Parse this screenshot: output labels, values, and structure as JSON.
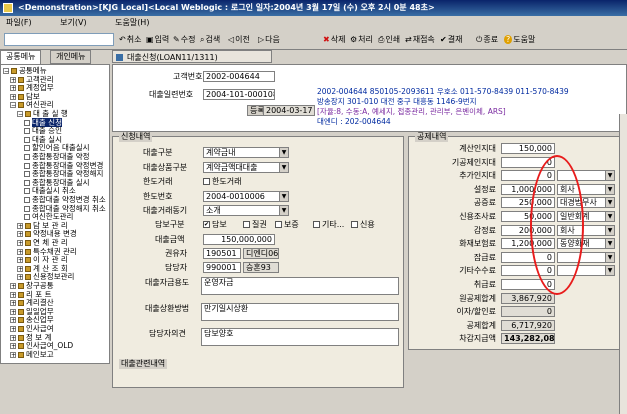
{
  "window": {
    "title": "<Demonstration>[KJG Local]<Local Weblogic : 로그인 일자:2004년 3월 17일 (수) 오후 2시 0분 48초>"
  },
  "menu": [
    "파일(F)",
    "보기(V)",
    "도움말(H)"
  ],
  "toolbar": [
    {
      "icon": "cancel-icon",
      "label": "취소"
    },
    {
      "icon": "new-icon",
      "label": "입력"
    },
    {
      "icon": "edit-icon",
      "label": "수정"
    },
    {
      "icon": "search-icon",
      "label": "검색"
    },
    {
      "icon": "prev-icon",
      "label": "이전"
    },
    {
      "icon": "next-icon",
      "label": "다음"
    },
    {
      "icon": "delete-icon",
      "label": "삭제"
    },
    {
      "icon": "process-icon",
      "label": "처리"
    },
    {
      "icon": "print-icon",
      "label": "인쇄"
    },
    {
      "icon": "reconnect-icon",
      "label": "재접속"
    },
    {
      "icon": "approve-icon",
      "label": "결재"
    },
    {
      "icon": "exit-icon",
      "label": "종료"
    },
    {
      "icon": "help-icon",
      "label": "도움말"
    }
  ],
  "side_tabs": [
    "공통메뉴",
    "개인메뉴"
  ],
  "tree": [
    {
      "label": "공통메뉴",
      "level": 0,
      "icon": "book"
    },
    {
      "label": "고객관리",
      "level": 1,
      "icon": "book"
    },
    {
      "label": "계정업무",
      "level": 1,
      "icon": "book"
    },
    {
      "label": "담보",
      "level": 1,
      "icon": "book"
    },
    {
      "label": "여신관리",
      "level": 1,
      "icon": "book"
    },
    {
      "label": "대 출 실 행",
      "level": 2,
      "icon": "book"
    },
    {
      "label": "대출 신청",
      "level": 3,
      "icon": "page"
    },
    {
      "label": "대출 승인",
      "level": 3,
      "icon": "page"
    },
    {
      "label": "대출 실시",
      "level": 3,
      "icon": "page"
    },
    {
      "label": "할인어음 대출실시",
      "level": 3,
      "icon": "page"
    },
    {
      "label": "종합통장대출 약정",
      "level": 3,
      "icon": "page"
    },
    {
      "label": "종합통장대출 약정변경",
      "level": 3,
      "icon": "page"
    },
    {
      "label": "종합통장대출 약정해지",
      "level": 3,
      "icon": "page"
    },
    {
      "label": "종합통장대출 실시",
      "level": 3,
      "icon": "page"
    },
    {
      "label": "대출실시 취소",
      "level": 3,
      "icon": "page"
    },
    {
      "label": "종합대출 약정변경 취소",
      "level": 3,
      "icon": "page"
    },
    {
      "label": "종합대출 약정해지 취소",
      "level": 3,
      "icon": "page"
    },
    {
      "label": "여신한도관리",
      "level": 3,
      "icon": "page"
    },
    {
      "label": "담 보 관 리",
      "level": 2,
      "icon": "book"
    },
    {
      "label": "약정내용 변경",
      "level": 2,
      "icon": "book"
    },
    {
      "label": "연 체 관 리",
      "level": 2,
      "icon": "book"
    },
    {
      "label": "특수채권 관리",
      "level": 2,
      "icon": "book"
    },
    {
      "label": "이 자 관 리",
      "level": 2,
      "icon": "book"
    },
    {
      "label": "계 산 조 회",
      "level": 2,
      "icon": "book"
    },
    {
      "label": "신용정보관리",
      "level": 2,
      "icon": "book"
    },
    {
      "label": "창구공통",
      "level": 1,
      "icon": "book"
    },
    {
      "label": "리 포 트",
      "level": 1,
      "icon": "book"
    },
    {
      "label": "계리결산",
      "level": 1,
      "icon": "book"
    },
    {
      "label": "일일업무",
      "level": 1,
      "icon": "book"
    },
    {
      "label": "송신업무",
      "level": 1,
      "icon": "book"
    },
    {
      "label": "인사급여",
      "level": 1,
      "icon": "book"
    },
    {
      "label": "정 보 계",
      "level": 1,
      "icon": "book"
    },
    {
      "label": "인사급여_OLD",
      "level": 1,
      "icon": "book"
    },
    {
      "label": "메인보고",
      "level": 1,
      "icon": "book"
    }
  ],
  "doc_tab": "대출신청(LOAN11/1311)",
  "header": {
    "customer_no_label": "고객번호",
    "customer_no": "2002-004644",
    "loan_app_no_label": "대출일련번호",
    "loan_app_no": "2004-101-000108",
    "reg_button": "등록",
    "reg_date": "2004-03-17",
    "info_lines": [
      "2002-004644   850105-2093611   우호소   011-570-8439   011-570-8439",
      "방송장지   301-010  대전 중구 대흥동   1146-9번지",
      "[자율:8, 수동:A, 예세지, 접종관리, 관리부, 은벤이체, ARS]",
      "대엔디 : 202-004644"
    ]
  },
  "left_group": {
    "title": "신청내역",
    "fields": [
      {
        "label": "대출구분",
        "value": "계약금내",
        "type": "select"
      },
      {
        "label": "대출상품구분",
        "value": "계약금액대대출",
        "type": "select"
      },
      {
        "label": "한도거래",
        "value": "한도거래",
        "type": "check"
      },
      {
        "label": "한도번호",
        "value": "2004-0010006",
        "type": "select"
      },
      {
        "label": "대출거래동기",
        "value": "소개",
        "type": "select"
      }
    ],
    "collateral_label": "담보구분",
    "collateral_options": [
      "담보",
      "질권",
      "보증",
      "기타...",
      "신용"
    ],
    "collateral_checked": "담보",
    "amount_label": "대출금액",
    "amount": "150,000,000",
    "broker_label": "권유자",
    "broker_id": "190501",
    "broker_name": "디엔디06",
    "manager_label": "담당자",
    "manager_id": "990001",
    "manager_name": "승혼93",
    "purpose_label": "대출자금용도",
    "purpose": "운영자금",
    "repay_label": "대출상환방법",
    "repay": "만기일시상환",
    "opinion_label": "담당자의견",
    "opinion": "담보양호",
    "bottom_title": "대출관련내역"
  },
  "right_group": {
    "title": "공제내역",
    "rows": [
      {
        "label": "계산인지대",
        "value": "150,000",
        "extra": "",
        "sel": false
      },
      {
        "label": "기공제인지대",
        "value": "0",
        "extra": "",
        "sel": false
      },
      {
        "label": "추가인지대",
        "value": "0",
        "extra": "",
        "sel": true
      },
      {
        "label": "설정료",
        "value": "1,000,000",
        "extra": "회사",
        "sel": true
      },
      {
        "label": "공증료",
        "value": "250,000",
        "extra": "대경법무사",
        "sel": true
      },
      {
        "label": "신용조사료",
        "value": "50,000",
        "extra": "일반회계",
        "sel": true
      },
      {
        "label": "감정료",
        "value": "200,000",
        "extra": "회사",
        "sel": true
      },
      {
        "label": "화재보험료",
        "value": "1,200,000",
        "extra": "동양화재",
        "sel": true
      },
      {
        "label": "잡급료",
        "value": "0",
        "extra": "",
        "sel": true
      },
      {
        "label": "기타수수료",
        "value": "0",
        "extra": "",
        "sel": true
      },
      {
        "label": "취급료",
        "value": "0",
        "extra": "",
        "sel": false
      },
      {
        "label": "원공제합계",
        "value": "3,867,920",
        "extra": "",
        "sel": false
      },
      {
        "label": "이자/할인료",
        "value": "0",
        "extra": "",
        "sel": false
      },
      {
        "label": "공제합계",
        "value": "6,717,920",
        "extra": "",
        "sel": false
      },
      {
        "label": "차감지급액",
        "value": "143,282,080",
        "extra": "",
        "sel": false
      }
    ]
  },
  "colors": {
    "title_bg": "#0a246a",
    "panel_bg": "#d4d0c8",
    "info_text": "#002aa0",
    "annotation": "#e81c1c"
  }
}
